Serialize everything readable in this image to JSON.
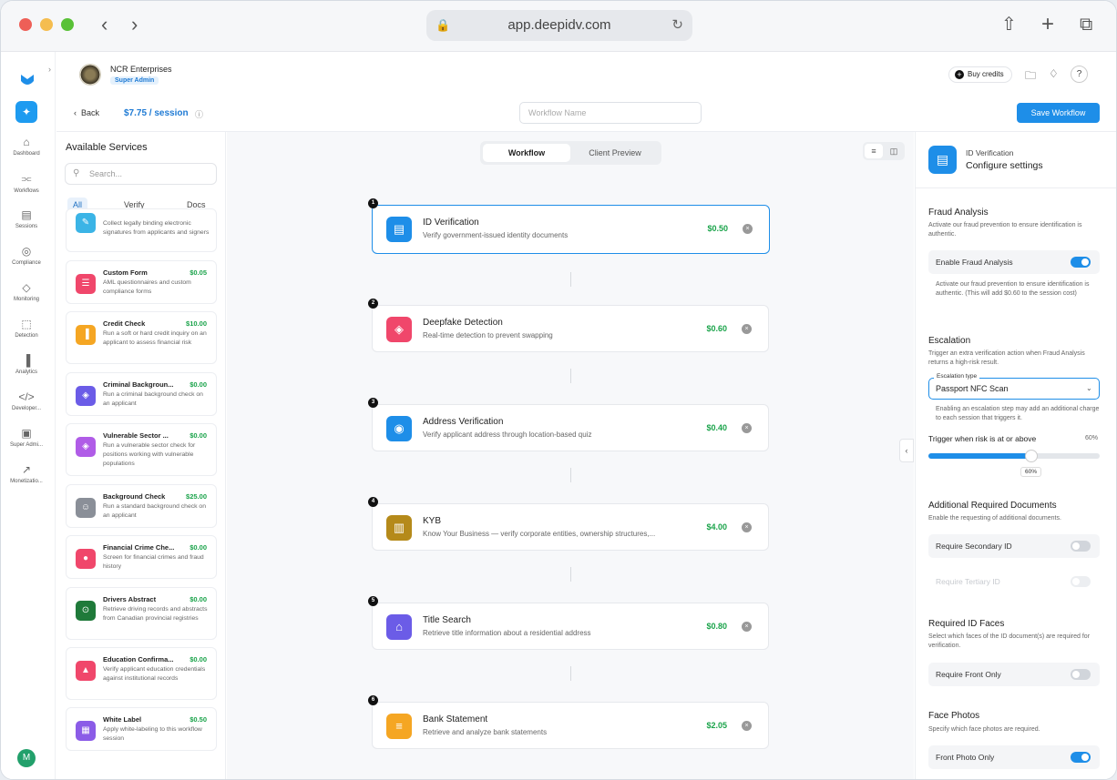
{
  "browser": {
    "url": "app.deepidv.com"
  },
  "org": {
    "name": "NCR Enterprises",
    "role": "Super Admin"
  },
  "header": {
    "buy_credits": "Buy credits",
    "back": "Back",
    "price": "$7.75 / session",
    "workflow_name_placeholder": "Workflow Name",
    "save": "Save Workflow"
  },
  "rail": [
    {
      "label": "Dashboard",
      "icon": "home-icon"
    },
    {
      "label": "Workflows",
      "icon": "workflow-icon"
    },
    {
      "label": "Sessions",
      "icon": "sessions-icon"
    },
    {
      "label": "Compliance",
      "icon": "globe-icon"
    },
    {
      "label": "Monitoring",
      "icon": "shield-icon"
    },
    {
      "label": "Detection",
      "icon": "scan-icon"
    },
    {
      "label": "Analytics",
      "icon": "analytics-icon"
    },
    {
      "label": "Developer...",
      "icon": "code-icon"
    },
    {
      "label": "Super Admi...",
      "icon": "briefcase-icon"
    },
    {
      "label": "Monetizatio...",
      "icon": "chart-line-icon"
    }
  ],
  "user_avatar": "M",
  "services": {
    "title": "Available Services",
    "search_placeholder": "Search...",
    "filters": [
      "All",
      "Verify",
      "Docs"
    ],
    "items": [
      {
        "name": "",
        "price": "",
        "desc": "Collect legally binding electronic signatures from applicants and signers",
        "color": "#3bb4e6",
        "icon": "signature-icon"
      },
      {
        "name": "Custom Form",
        "price": "$0.05",
        "desc": "AML questionnaires and custom compliance forms",
        "color": "#f0476b",
        "icon": "form-icon"
      },
      {
        "name": "Credit Check",
        "price": "$10.00",
        "desc": "Run a soft or hard credit inquiry on an applicant to assess financial risk",
        "color": "#f5a623",
        "icon": "credit-icon"
      },
      {
        "name": "Criminal Backgroun...",
        "price": "$0.00",
        "desc": "Run a criminal background check on an applicant",
        "color": "#6b5ce7",
        "icon": "criminal-shield-icon"
      },
      {
        "name": "Vulnerable Sector ...",
        "price": "$0.00",
        "desc": "Run a vulnerable sector check for positions working with vulnerable populations",
        "color": "#b05ce7",
        "icon": "vulnerable-shield-icon"
      },
      {
        "name": "Background Check",
        "price": "$25.00",
        "desc": "Run a standard background check on an applicant",
        "color": "#8a8f98",
        "icon": "person-icon"
      },
      {
        "name": "Financial Crime Che...",
        "price": "$0.00",
        "desc": "Screen for financial crimes and fraud history",
        "color": "#f0476b",
        "icon": "financial-crime-icon"
      },
      {
        "name": "Drivers Abstract",
        "price": "$0.00",
        "desc": "Retrieve driving records and abstracts from Canadian provincial registries",
        "color": "#1f7a3a",
        "icon": "steering-icon"
      },
      {
        "name": "Education Confirma...",
        "price": "$0.00",
        "desc": "Verify applicant education credentials against institutional records",
        "color": "#f0476b",
        "icon": "graduation-icon"
      },
      {
        "name": "White Label",
        "price": "$0.50",
        "desc": "Apply white-labeling to this workflow session",
        "color": "#8b5ce7",
        "icon": "white-label-icon"
      }
    ]
  },
  "canvas": {
    "tabs": [
      "Workflow",
      "Client Preview"
    ],
    "steps": [
      {
        "num": "1",
        "name": "ID Verification",
        "desc": "Verify government-issued identity documents",
        "price": "$0.50",
        "color": "#1e8ee8",
        "icon": "id-card-icon"
      },
      {
        "num": "2",
        "name": "Deepfake Detection",
        "desc": "Real-time detection to prevent swapping",
        "price": "$0.60",
        "color": "#f0476b",
        "icon": "deepfake-shield-icon"
      },
      {
        "num": "3",
        "name": "Address Verification",
        "desc": "Verify applicant address through location-based quiz",
        "price": "$0.40",
        "color": "#1e8ee8",
        "icon": "location-pin-icon"
      },
      {
        "num": "4",
        "name": "KYB",
        "desc": "Know Your Business — verify corporate entities, ownership structures,...",
        "price": "$4.00",
        "color": "#b58a1a",
        "icon": "building-icon"
      },
      {
        "num": "5",
        "name": "Title Search",
        "desc": "Retrieve title information about a residential address",
        "price": "$0.80",
        "color": "#6b5ce7",
        "icon": "house-icon"
      },
      {
        "num": "6",
        "name": "Bank Statement",
        "desc": "Retrieve and analyze bank statements",
        "price": "$2.05",
        "color": "#f5a623",
        "icon": "document-icon"
      }
    ]
  },
  "settings": {
    "subtitle": "ID Verification",
    "title": "Configure settings",
    "fraud": {
      "heading": "Fraud Analysis",
      "desc": "Activate our fraud prevention to ensure identification is authentic.",
      "toggle_label": "Enable Fraud Analysis",
      "toggle_on": true,
      "note": "Activate our fraud prevention to ensure identification is authentic. (This will add $0.60 to the session cost)"
    },
    "escalation": {
      "heading": "Escalation",
      "desc": "Trigger an extra verification action when Fraud Analysis returns a high-risk result.",
      "type_label": "Escalation type",
      "type_value": "Passport NFC Scan",
      "note": "Enabling an escalation step may add an additional charge to each session that triggers it.",
      "trigger_label": "Trigger when risk is at or above",
      "trigger_value": "60%",
      "slider_level": 0.6
    },
    "docs": {
      "heading": "Additional Required Documents",
      "desc": "Enable the requesting of additional documents.",
      "secondary": "Require Secondary ID",
      "tertiary": "Require Tertiary ID"
    },
    "faces": {
      "heading": "Required ID Faces",
      "desc": "Select which faces of the ID document(s) are required for verification.",
      "front_only": "Require Front Only"
    },
    "photos": {
      "heading": "Face Photos",
      "desc": "Specify which face photos are required.",
      "front_photo": "Front Photo Only"
    }
  }
}
